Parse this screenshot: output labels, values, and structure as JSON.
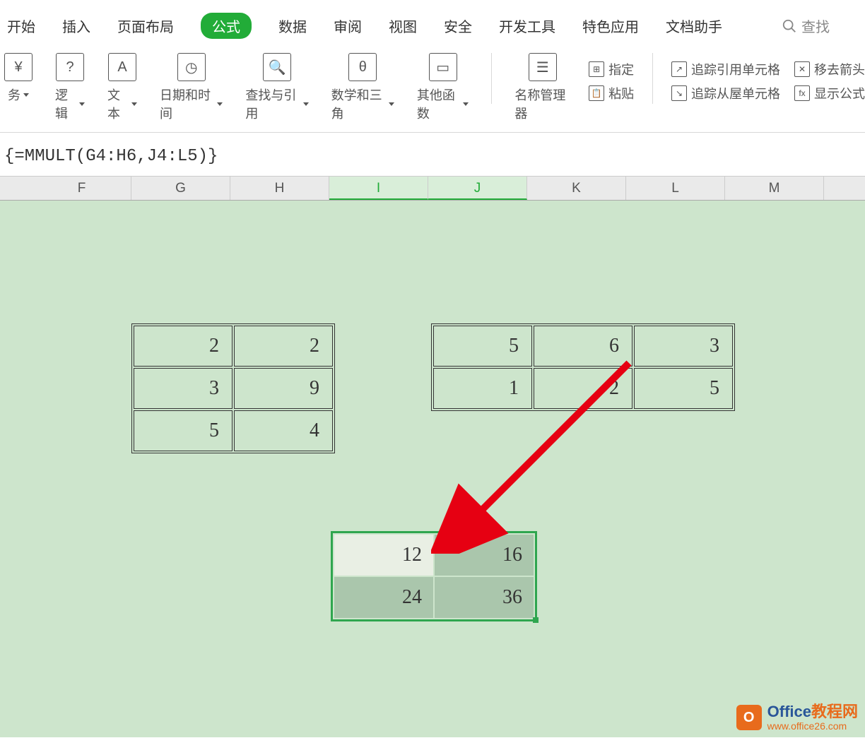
{
  "menu": {
    "start": "开始",
    "insert": "插入",
    "layout": "页面布局",
    "formula": "公式",
    "data": "数据",
    "review": "审阅",
    "view": "视图",
    "security": "安全",
    "devtools": "开发工具",
    "special": "特色应用",
    "docassist": "文档助手",
    "search": "查找"
  },
  "ribbon": {
    "finance": "务",
    "logic": "逻辑",
    "text": "文本",
    "datetime": "日期和时间",
    "lookup": "查找与引用",
    "mathtrig": "数学和三角",
    "other": "其他函数",
    "namemgr": "名称管理器",
    "assign": "指定",
    "paste": "粘贴",
    "trace_ref": "追踪引用单元格",
    "trace_dep": "追踪从屋单元格",
    "remove_arrows": "移去箭头",
    "show_formula": "显示公式"
  },
  "formula_bar": "{=MMULT(G4:H6,J4:L5)}",
  "columns": [
    "F",
    "G",
    "H",
    "I",
    "J",
    "K",
    "L",
    "M"
  ],
  "selected_cols": [
    "I",
    "J"
  ],
  "matrix_a": [
    [
      "2",
      "2"
    ],
    [
      "3",
      "9"
    ],
    [
      "5",
      "4"
    ]
  ],
  "matrix_b": [
    [
      "5",
      "6",
      "3"
    ],
    [
      "1",
      "2",
      "5"
    ]
  ],
  "result": [
    [
      "12",
      "16"
    ],
    [
      "24",
      "36"
    ]
  ],
  "watermark": {
    "title_prefix": "Office",
    "title_suffix": "教程网",
    "url": "www.office26.com"
  }
}
